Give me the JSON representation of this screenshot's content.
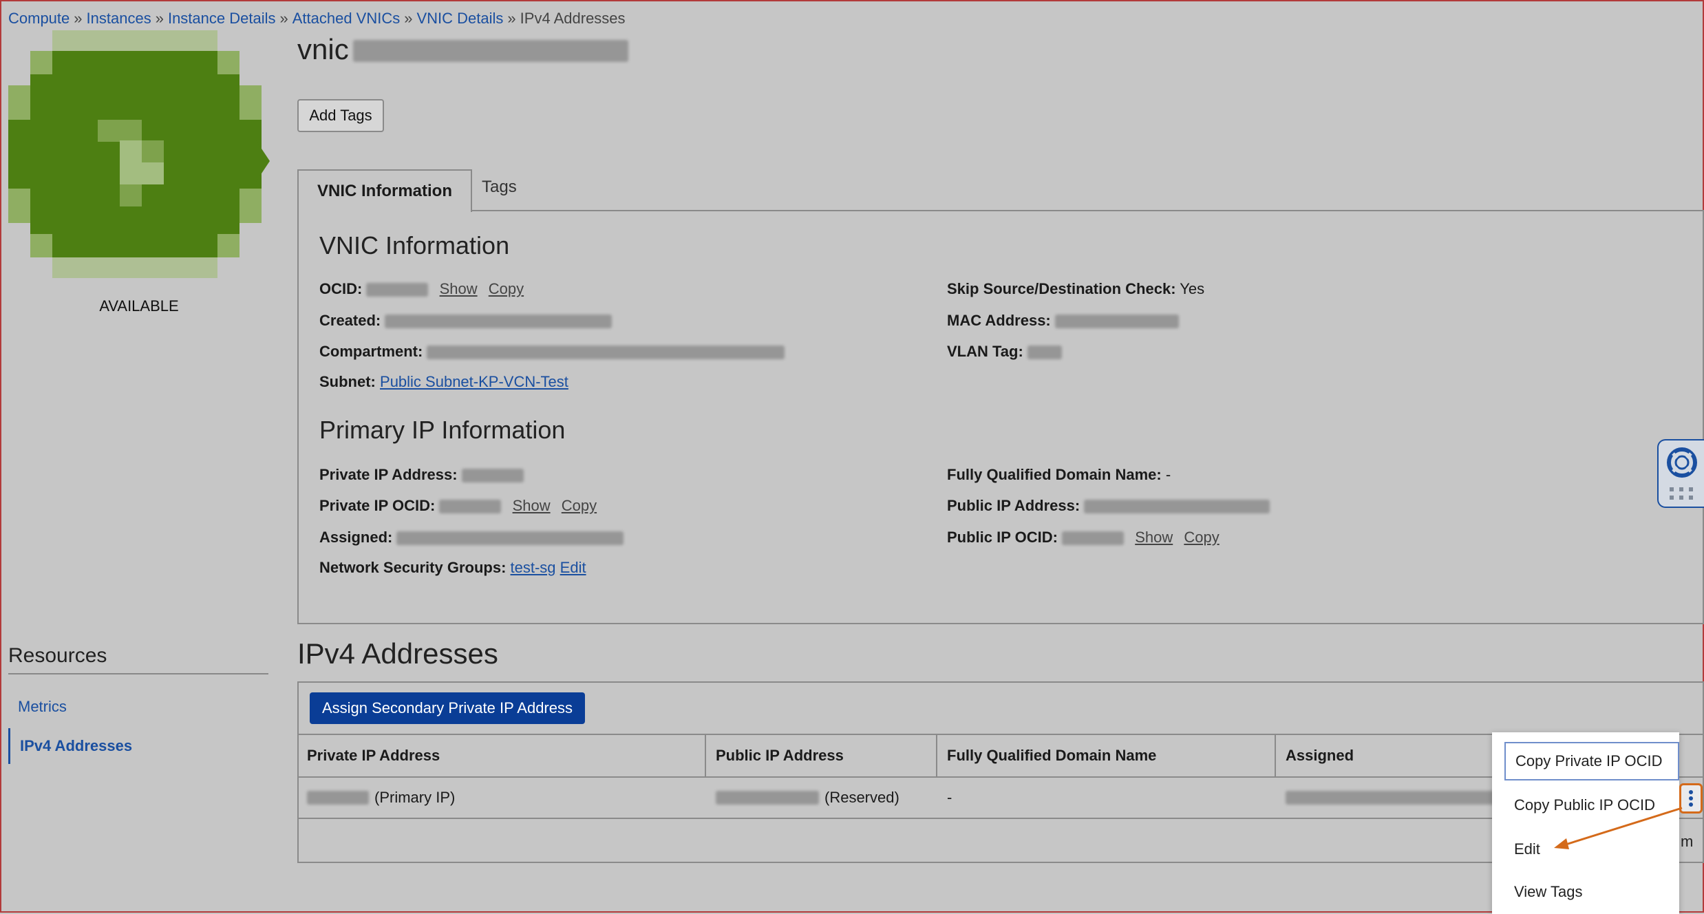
{
  "breadcrumb": {
    "items": [
      "Compute",
      "Instances",
      "Instance Details",
      "Attached VNICs",
      "VNIC Details"
    ],
    "separator": "»",
    "current": "IPv4 Addresses"
  },
  "avatar": {
    "status": "AVAILABLE",
    "color": "#4d7f12"
  },
  "page_title": "vnic",
  "add_tags_label": "Add Tags",
  "tabs": [
    "VNIC Information",
    "Tags"
  ],
  "vnic_info": {
    "heading": "VNIC Information",
    "ocid_label": "OCID:",
    "show": "Show",
    "copy": "Copy",
    "created_label": "Created:",
    "compartment_label": "Compartment:",
    "subnet_label": "Subnet:",
    "subnet_value": "Public Subnet-KP-VCN-Test",
    "skip_check_label": "Skip Source/Destination Check:",
    "skip_check_value": "Yes",
    "mac_label": "MAC Address:",
    "vlan_label": "VLAN Tag:"
  },
  "primary_ip": {
    "heading": "Primary IP Information",
    "private_ip_label": "Private IP Address:",
    "private_ocid_label": "Private IP OCID:",
    "assigned_label": "Assigned:",
    "nsg_label": "Network Security Groups:",
    "nsg_value": "test-sg",
    "nsg_edit": "Edit",
    "fqdn_label": "Fully Qualified Domain Name:",
    "fqdn_value": "-",
    "public_ip_label": "Public IP Address:",
    "public_ocid_label": "Public IP OCID:"
  },
  "resources": {
    "title": "Resources",
    "items": [
      "Metrics",
      "IPv4 Addresses"
    ]
  },
  "ipv4": {
    "heading": "IPv4 Addresses",
    "assign_button": "Assign Secondary Private IP Address",
    "columns": [
      "Private IP Address",
      "Public IP Address",
      "Fully Qualified Domain Name",
      "Assigned"
    ],
    "row": {
      "private_suffix": "(Primary IP)",
      "public_suffix": "(Reserved)",
      "fqdn": "-"
    }
  },
  "menu": {
    "items": [
      "Copy Private IP OCID",
      "Copy Public IP OCID",
      "Edit",
      "View Tags"
    ]
  },
  "colors": {
    "accent": "#0a3d96",
    "link": "#1a4fa0",
    "highlight": "#d46a1a"
  }
}
